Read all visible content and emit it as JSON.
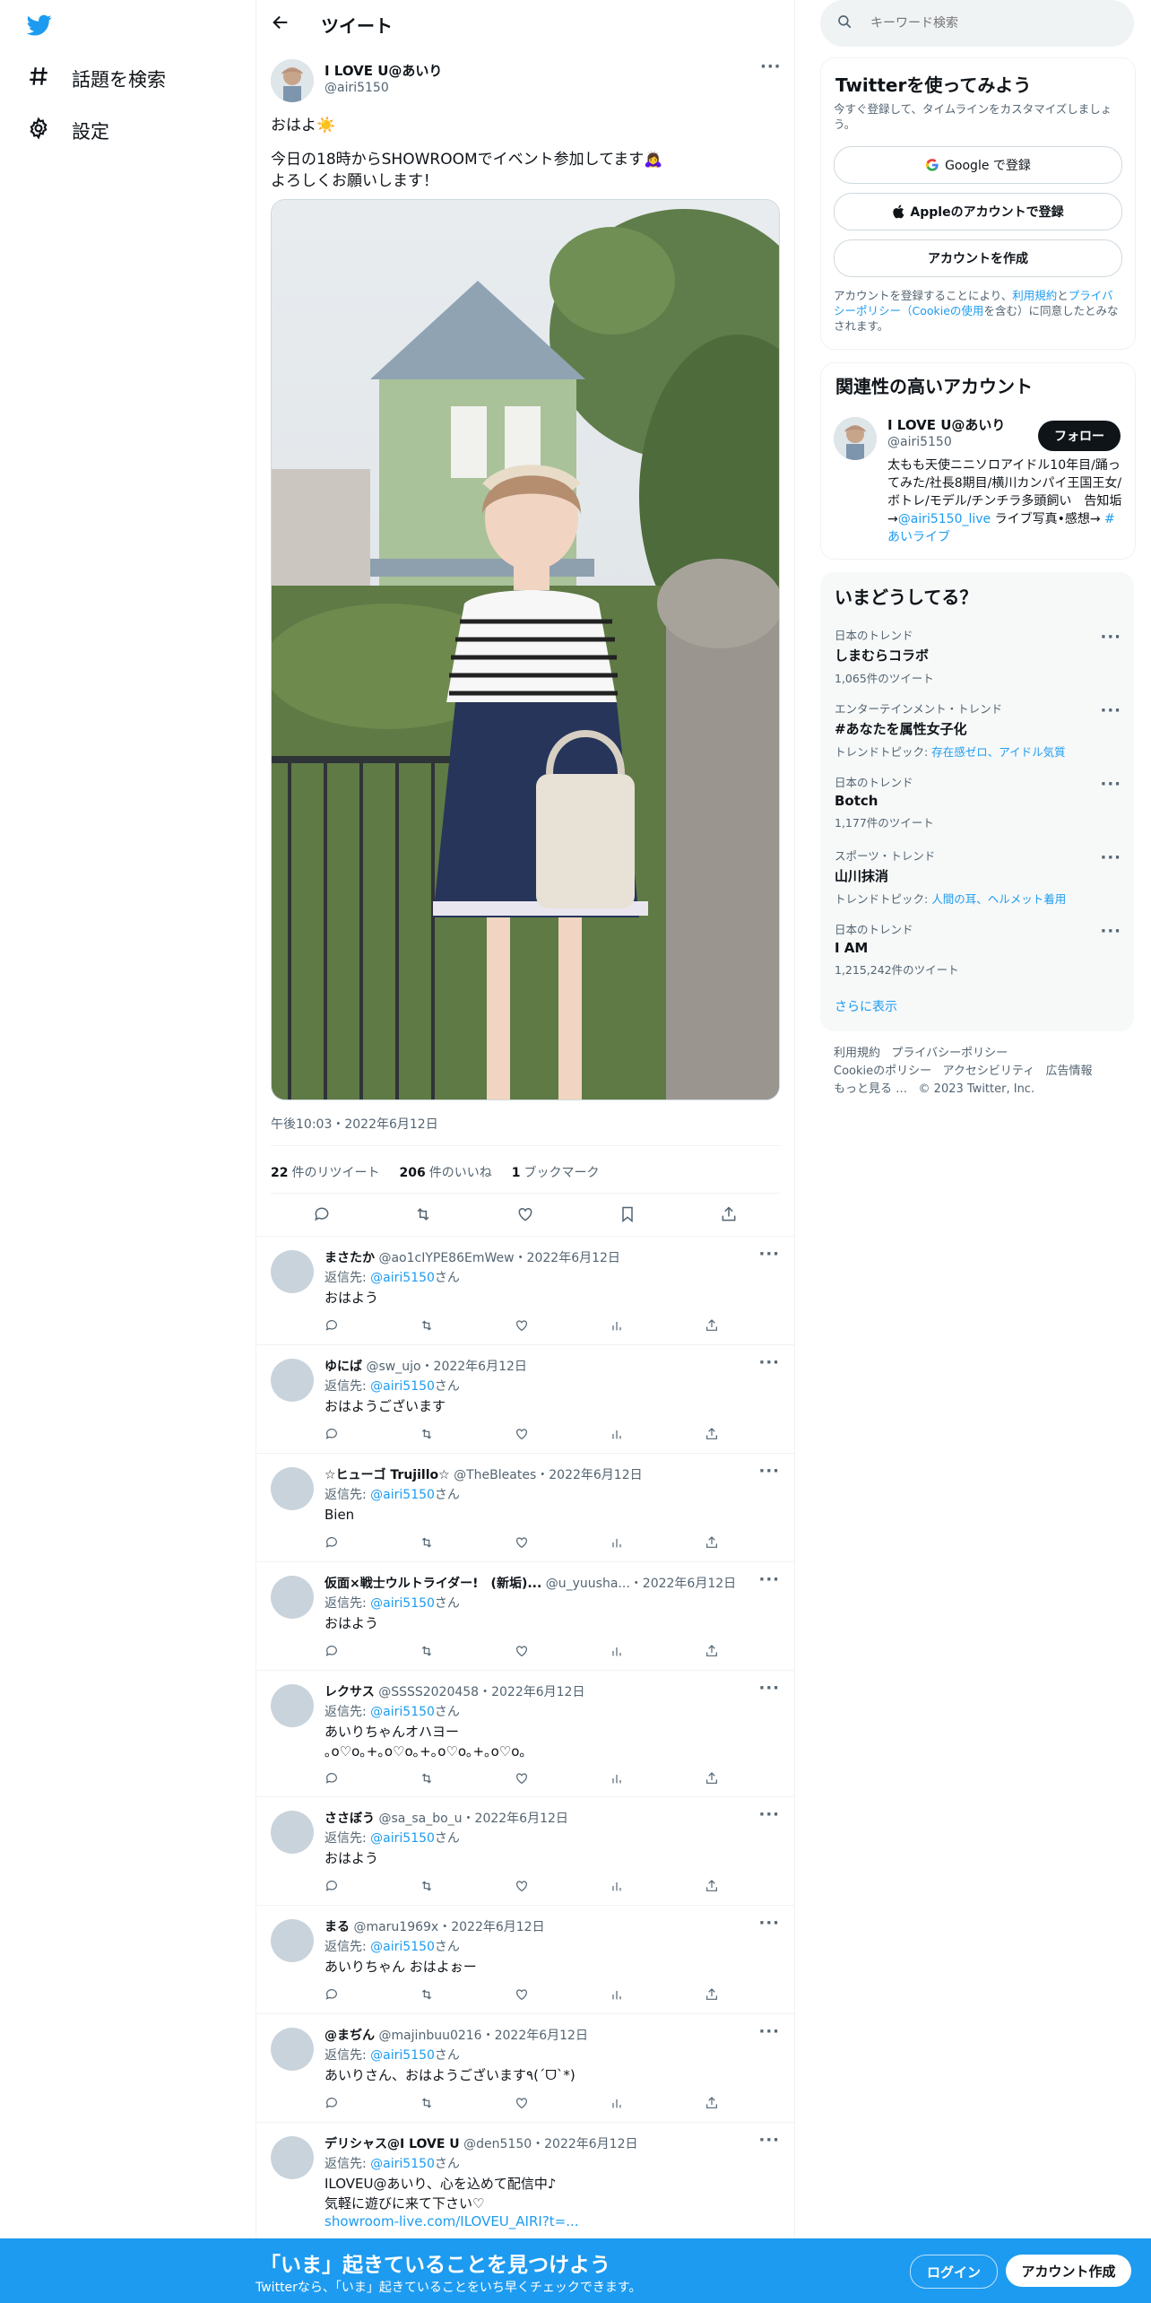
{
  "colors": {
    "accent": "#1d9bf0",
    "text": "#0f1419",
    "muted": "#536471",
    "border": "#eff3f4"
  },
  "nav": {
    "logo_icon": "twitter-bird-icon",
    "items": [
      {
        "icon": "hashtag-icon",
        "label": "話題を検索"
      },
      {
        "icon": "gear-icon",
        "label": "設定"
      }
    ]
  },
  "header": {
    "back_icon": "arrow-left-icon",
    "title": "ツイート"
  },
  "tweet": {
    "name": "I LOVE U@あいり",
    "handle": "@airi5150",
    "line1": "おはよ☀️",
    "line2": "今日の18時からSHOWROOMでイベント参加してます🙇‍♀️",
    "line3": "よろしくお願いします！",
    "timestamp": "午後10:03・2022年6月12日",
    "retweets": "22",
    "retweets_label": "件のリツイート",
    "likes": "206",
    "likes_label": "件のいいね",
    "bookmarks": "1",
    "bookmarks_label": "ブックマーク"
  },
  "replies": [
    {
      "name": "まさたか",
      "handle": "@ao1cIYPE86EmWew",
      "date": "・2022年6月12日",
      "to_prefix": "返信先: ",
      "to_handle": "@airi5150",
      "to_suffix": "さん",
      "text": "おはよう"
    },
    {
      "name": "ゆにば",
      "handle": "@sw_ujo",
      "date": "・2022年6月12日",
      "to_prefix": "返信先: ",
      "to_handle": "@airi5150",
      "to_suffix": "さん",
      "text": "おはようございます"
    },
    {
      "name": "☆ヒューゴ Trujillo☆",
      "handle": "@TheBleates",
      "date": "・2022年6月12日",
      "to_prefix": "返信先: ",
      "to_handle": "@airi5150",
      "to_suffix": "さん",
      "text": "Bien"
    },
    {
      "name": "仮面×戦士ウルトライダー!　(新垢)...",
      "handle": "@u_yuusha...",
      "date": "・2022年6月12日",
      "to_prefix": "返信先: ",
      "to_handle": "@airi5150",
      "to_suffix": "さん",
      "text": "おはよう"
    },
    {
      "name": "レクサス",
      "handle": "@SSSS2020458",
      "date": "・2022年6月12日",
      "to_prefix": "返信先: ",
      "to_handle": "@airi5150",
      "to_suffix": "さん",
      "text": "あいりちゃんオハヨー\n｡o♡o｡+｡o♡o｡+｡o♡o｡+｡o♡o｡"
    },
    {
      "name": "ささぼう",
      "handle": "@sa_sa_bo_u",
      "date": "・2022年6月12日",
      "to_prefix": "返信先: ",
      "to_handle": "@airi5150",
      "to_suffix": "さん",
      "text": "おはよう"
    },
    {
      "name": "まる",
      "handle": "@maru1969x",
      "date": "・2022年6月12日",
      "to_prefix": "返信先: ",
      "to_handle": "@airi5150",
      "to_suffix": "さん",
      "text": "あいりちゃん おはよぉー"
    },
    {
      "name": "@まぢん",
      "handle": "@majinbuu0216",
      "date": "・2022年6月12日",
      "to_prefix": "返信先: ",
      "to_handle": "@airi5150",
      "to_suffix": "さん",
      "text": "あいりさん、おはようございます٩(ˊᗜˋ*)"
    },
    {
      "name": "デリシャス@I LOVE U",
      "handle": "@den5150",
      "date": "・2022年6月12日",
      "to_prefix": "返信先: ",
      "to_handle": "@airi5150",
      "to_suffix": "さん",
      "text": "ILOVEU@あいり、心を込めて配信中♪\n気軽に遊びに来て下さい♡",
      "link": "showroom-live.com/ILOVEU_AIRI?t=..."
    }
  ],
  "search": {
    "placeholder": "キーワード検索"
  },
  "signup": {
    "title": "Twitterを使ってみよう",
    "subtitle": "今すぐ登録して、タイムラインをカスタマイズしましょう。",
    "google": "Google で登録",
    "apple": "Appleのアカウントで登録",
    "create": "アカウントを作成",
    "terms_1": "アカウントを登録することにより、",
    "terms_link1": "利用規約",
    "terms_2": "と",
    "terms_link2": "プライバシーポリシー（Cookieの使用",
    "terms_3": "を含む）に同意したとみなされます。"
  },
  "related": {
    "title": "関連性の高いアカウント",
    "name": "I LOVE U@あいり",
    "handle": "@airi5150",
    "follow": "フォロー",
    "bio": "太もも天使ニニソロアイドル10年目/踊ってみた/社長8期目/横川カンパイ王国王女/ボトレ/モデル/チンチラ多頭飼い　告知垢→",
    "bio_link1": "@airi5150_live",
    "bio_mid": " ライブ写真•感想→ ",
    "bio_link2": "#あいライブ"
  },
  "trends": {
    "title": "いまどうしてる？",
    "items": [
      {
        "category": "日本のトレンド",
        "name": "しまむらコラボ",
        "sub": "1,065件のツイート"
      },
      {
        "category": "エンターテインメント・トレンド",
        "name": "#あなたを属性女子化",
        "sub_prefix": "トレンドトピック: ",
        "sub_link": "存在感ゼロ、アイドル気質"
      },
      {
        "category": "日本のトレンド",
        "name": "Botch",
        "sub": "1,177件のツイート"
      },
      {
        "category": "スポーツ・トレンド",
        "name": "山川抹消",
        "sub_prefix": "トレンドトピック: ",
        "sub_link": "人間の耳、ヘルメット着用"
      },
      {
        "category": "日本のトレンド",
        "name": "I AM",
        "sub": "1,215,242件のツイート"
      }
    ],
    "more": "さらに表示"
  },
  "footer": {
    "terms": "利用規約",
    "privacy": "プライバシーポリシー",
    "cookie": "Cookieのポリシー",
    "accessibility": "アクセシビリティ",
    "ads": "広告情報",
    "more": "もっと見る …",
    "copyright": "© 2023 Twitter, Inc."
  },
  "banner": {
    "title": "「いま」起きていることを見つけよう",
    "subtitle": "Twitterなら、「いま」起きていることをいち早くチェックできます。",
    "login": "ログイン",
    "signup": "アカウント作成"
  }
}
